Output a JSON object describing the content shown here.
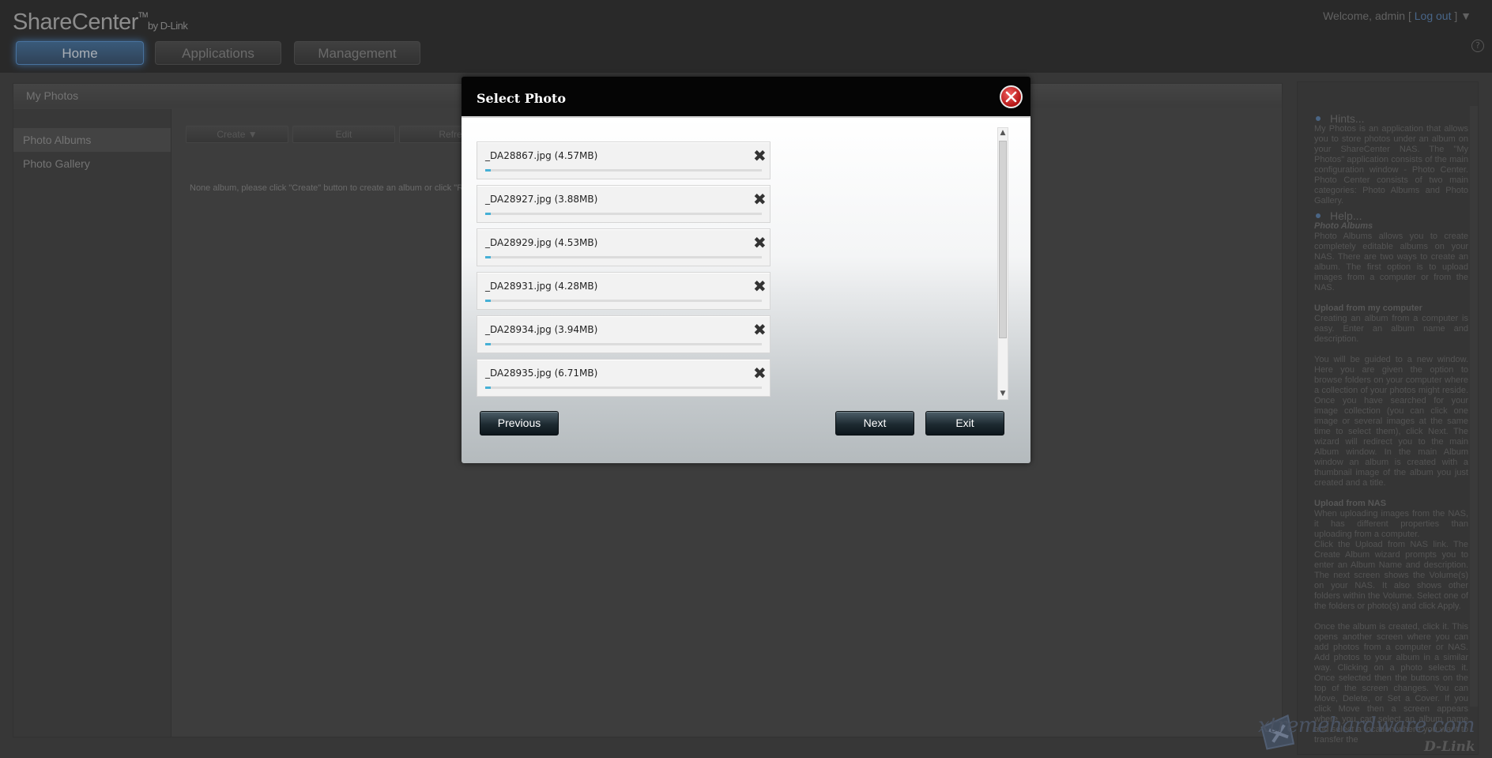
{
  "header": {
    "brand": "ShareCenter",
    "brand_tm": "TM",
    "brand_by": "by D-Link",
    "welcome_prefix": "Welcome, admin [ ",
    "logout": "Log out",
    "welcome_suffix": " ] ▼",
    "help": "?",
    "nav": [
      {
        "label": "Home",
        "active": true
      },
      {
        "label": "Applications",
        "active": false
      },
      {
        "label": "Management",
        "active": false
      }
    ]
  },
  "app": {
    "title": "My Photos",
    "sidebar": [
      "Photo Albums",
      "Photo Gallery"
    ],
    "toolbar": {
      "create": "Create ▼",
      "edit": "Edit",
      "refresh": "Refre"
    },
    "empty_message": "None album, please click \"Create\" button to create an album or click \"Re"
  },
  "hints": {
    "hints_title": "Hints...",
    "hints_text": "My Photos is an application that allows you to store photos under an album on your ShareCenter NAS. The \"My Photos\" application consists of the main configuration window - Photo Center. Photo Center consists of two main categories: Photo Albums and Photo Gallery.",
    "help_title": "Help...",
    "help_sub": "Photo Albums",
    "help_text": "Photo Albums allows you to create completely editable albums on your NAS. There are two ways to create an album. The first option is to upload images from a computer or from the NAS.",
    "upload_computer_title": "Upload from my computer",
    "upload_computer_text1": "Creating an album from a computer is easy. Enter an album name and description.",
    "upload_computer_text2": "You will be guided to a new window. Here you are given the option to browse folders on your computer where a collection of your photos might reside. Once you have searched for your image collection (you can click one image or several images at the same time to select them), click Next. The wizard will redirect you to the main Album window. In the main Album window an album is created with a thumbnail image of the album you just created and a title.",
    "upload_nas_title": "Upload from NAS",
    "upload_nas_text1": "When uploading images from the NAS, it has different properties than uploading from a computer.",
    "upload_nas_text2": "Click the Upload from NAS link. The Create Album wizard prompts you to enter an Album Name and description. The next screen shows the Volume(s) on your NAS. It also shows other folders within the Volume. Select one of the folders or photo(s) and click Apply.",
    "upload_nas_text3": "Once the album is created, click it. This opens another screen where you can add photos from a computer or NAS. Add photos to your album in a similar way. Clicking on a photo selects it. Once selected then the buttons on the top of the screen changes. You can Move, Delete, or Set a Cover. If you click Move then a screen appears where you can select an album name and select a location where you want to transfer the"
  },
  "watermark": "xtremehardware.com",
  "footer_logo": "D-Link",
  "modal": {
    "title": "Select Photo",
    "files": [
      {
        "name": "_DA28867.jpg (4.57MB)",
        "progress": 0.005
      },
      {
        "name": "_DA28927.jpg (3.88MB)",
        "progress": 0.005
      },
      {
        "name": "_DA28929.jpg (4.53MB)",
        "progress": 0.005
      },
      {
        "name": "_DA28931.jpg (4.28MB)",
        "progress": 0.005
      },
      {
        "name": "_DA28934.jpg (3.94MB)",
        "progress": 0.005
      },
      {
        "name": "_DA28935.jpg (6.71MB)",
        "progress": 0.005
      }
    ],
    "remove_glyph": "✖",
    "buttons": {
      "previous": "Previous",
      "next": "Next",
      "exit": "Exit"
    },
    "colors": {
      "progress": "#46b0d6",
      "close": "#c42020"
    }
  }
}
